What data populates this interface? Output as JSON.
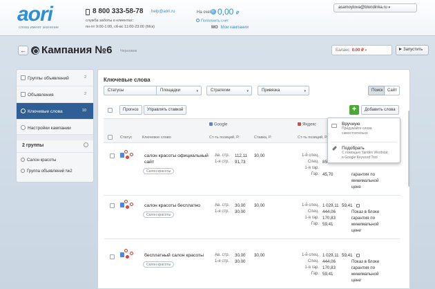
{
  "brand": {
    "logo_text": "aori",
    "slogan": "слова имеют значение"
  },
  "header": {
    "phone": "8 800 333-58-78",
    "email": "help@aori.ru",
    "support_line1": "служба заботы о клиентах:",
    "support_line2": "пн-пт 9:00-1:00, сб-вс 11:00-23:00 (Мск)",
    "account_label": "На счету:",
    "account_value": "0,00",
    "currency": "₽",
    "topup_link": "Пополнить счет",
    "user_initials": "МО",
    "my_campaigns_link": "Мои кампании",
    "user_email": "asamoylova@blondinka.ru"
  },
  "titlebar": {
    "back_label": "←",
    "campaign_title": "Кампания №6",
    "campaign_status": "Черновик",
    "balance_label": "Баланс:",
    "balance_value": "0.00 ₽",
    "start_label": "Запустить"
  },
  "sidebar": {
    "items": [
      {
        "label": "Группы объявлений",
        "count": "2"
      },
      {
        "label": "Объявления",
        "count": "2"
      },
      {
        "label": "Ключевые слова",
        "count": "10",
        "active": true
      },
      {
        "label": "Настройки кампании",
        "count": ""
      }
    ],
    "groups_title": "2 группы",
    "groups": [
      "Салон красоты",
      "Группа объявлений №2"
    ]
  },
  "main": {
    "title": "Ключевые слова",
    "filters": [
      "Статусы",
      "Площадки",
      "Стратегии",
      "Привязка"
    ],
    "view_tabs": [
      "Поиск",
      "Сайт"
    ],
    "buttons": {
      "forecast": "Прогноз",
      "manage_bid": "Управлять ставкой",
      "add_words": "Добавить слова",
      "add_plus": "+"
    },
    "engines": {
      "google": "Google",
      "yandex": "Яндекс"
    },
    "columns": {
      "status": "Статус",
      "keyword": "Ключевое слово",
      "google_cost": "Ст-ть позиций, Р.",
      "google_bid": "Ставка, Р.",
      "yandex_cost": "Ст-ть позиций, Р."
    },
    "dropdown": {
      "manual_title": "Вручную",
      "manual_desc_1": "Придумайте слова",
      "manual_desc_2": "самостоятельно",
      "pick_title": "Подобрать",
      "pick_desc_1": "С помощью Yandex Wordstat",
      "pick_desc_2": "и Google Keyword Tool"
    },
    "rows": [
      {
        "keyword_1": "салон красоты официальный",
        "keyword_2": "сайт",
        "tag": "Салон красоты",
        "g_labels": [
          "Ав. стр.",
          "1-я стр."
        ],
        "g_values": [
          "112,11",
          "91,73"
        ],
        "bid": "30,00",
        "y_labels": [
          "1-й спец.",
          "Спец.",
          "1-я гар.",
          "Гар."
        ],
        "y_values": [
          "",
          "85",
          "",
          "45,70"
        ],
        "guarantee": [
          "гарантия по",
          "минимальной",
          "цене"
        ]
      },
      {
        "keyword_1": "салон красоты бесплатно",
        "keyword_2": "",
        "tag": "Салон красоты",
        "g_labels": [
          "Ав. стр.",
          "1-я стр."
        ],
        "g_values": [
          "30,00",
          "30,00"
        ],
        "bid": "30,00",
        "y_labels": [
          "1-й спец.",
          "Спец.",
          "1-я гар.",
          "Гар."
        ],
        "y_values": [
          "1 029,11",
          "444,06",
          "170,83",
          "59,41"
        ],
        "guarantee_bid": "59,41",
        "guarantee": [
          "Показ в блоке",
          "гарантия по",
          "минимальной",
          "цене"
        ]
      },
      {
        "keyword_1": "бесплатный салон красоты",
        "keyword_2": "",
        "tag": "Салон красоты",
        "g_labels": [
          "Ав. стр.",
          "1-я стр."
        ],
        "g_values": [
          "30,00",
          "30,00"
        ],
        "bid": "30,00",
        "y_labels": [
          "1-й спец.",
          "Спец.",
          "1-я гар.",
          "Гар."
        ],
        "y_values": [
          "1 029,11",
          "444,06",
          "170,83",
          "59,41"
        ],
        "guarantee_bid": "59,41",
        "guarantee": [
          "Показ в блоке",
          "гарантия по",
          "минимальной",
          "цене"
        ]
      }
    ]
  },
  "colors": {
    "accent": "#2f5f95",
    "link": "#3c8dc5",
    "add_green": "#4aa935",
    "logo_blue": "#2b8fd8",
    "danger": "#c0392b"
  }
}
